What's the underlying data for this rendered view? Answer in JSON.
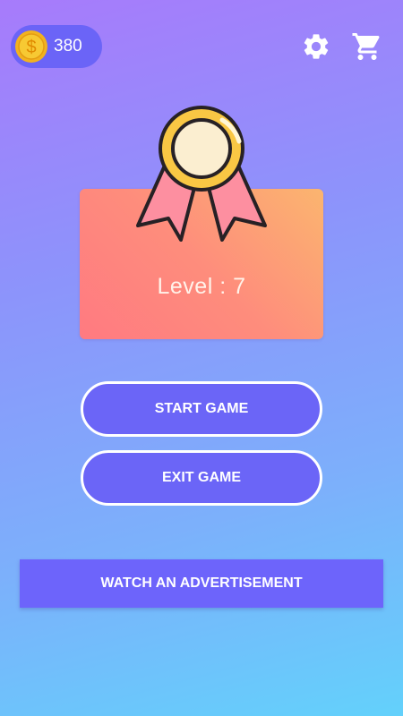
{
  "header": {
    "coin_count": "380",
    "coin_symbol": "$",
    "coin_icon": "gold-coin",
    "settings_icon": "gear-icon",
    "cart_icon": "shopping-cart-icon"
  },
  "level_card": {
    "level_text": "Level : 7",
    "badge_icon": "ribbon-medal"
  },
  "buttons": {
    "start_label": "START GAME",
    "exit_label": "EXIT GAME",
    "ad_label": "WATCH AN ADVERTISEMENT"
  },
  "colors": {
    "background_top": "#a77bfb",
    "background_bottom": "#63d1fb",
    "button_fill": "#6b65f7",
    "card_left": "#ff7a81",
    "card_right": "#fbb56f",
    "coin": "#f5c02e",
    "ribbon": "#fd8fa0"
  }
}
